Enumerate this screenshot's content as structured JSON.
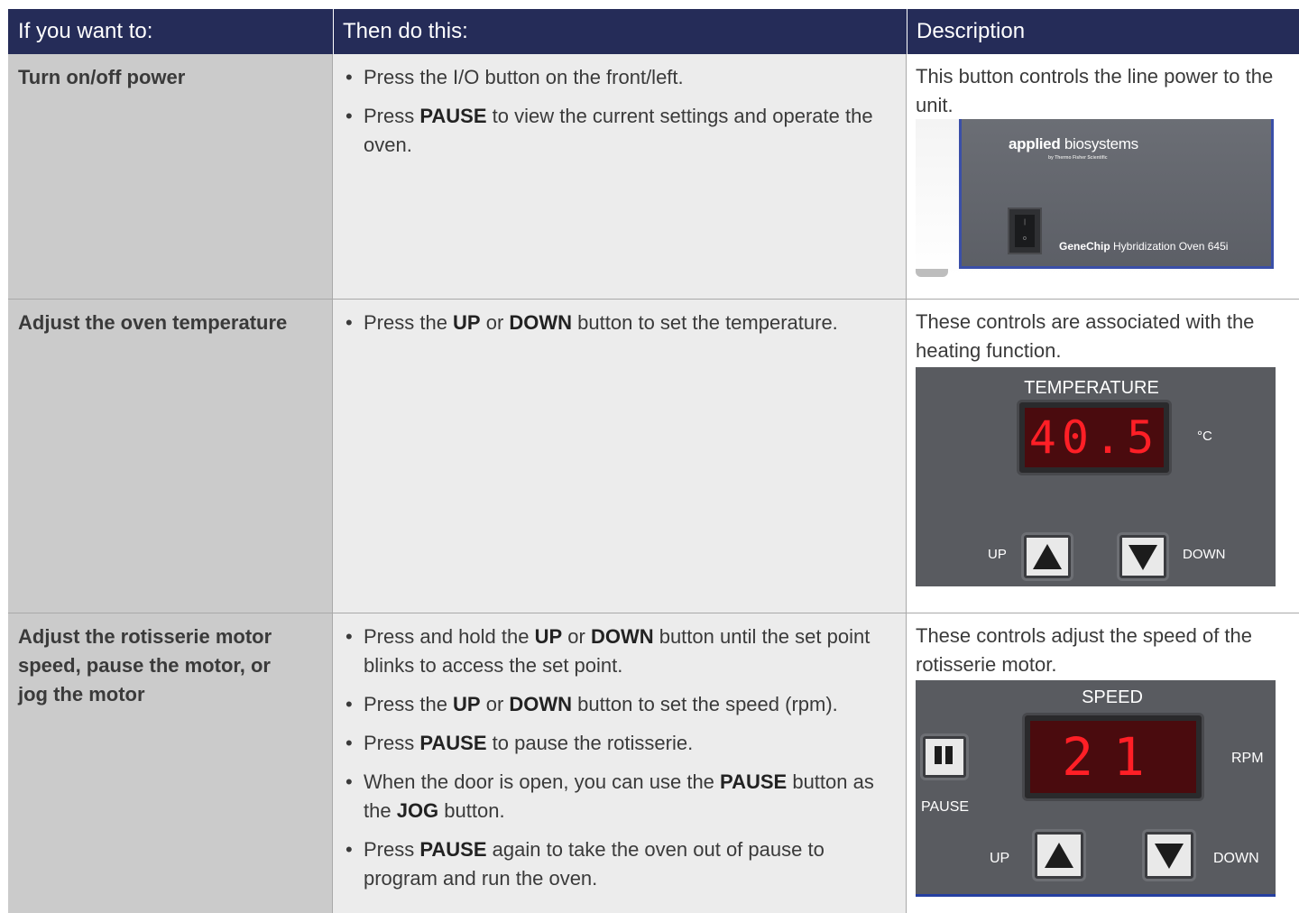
{
  "header": {
    "col1": "If you want to:",
    "col2": "Then do this:",
    "col3": "Description"
  },
  "rows": [
    {
      "want": "Turn on/off power",
      "steps": [
        {
          "parts": [
            {
              "t": "Press the I/O button on the front/left."
            }
          ]
        },
        {
          "parts": [
            {
              "t": "Press "
            },
            {
              "t": "PAUSE",
              "b": true
            },
            {
              "t": " to view the current settings and operate the oven."
            }
          ]
        }
      ],
      "description": "This button controls the line power to the unit.",
      "image": {
        "brand_bold": "applied",
        "brand_rest": " biosystems",
        "brand_sub": "by Thermo Fisher Scientific",
        "model_bold": "GeneChip",
        "model_rest": " Hybridization Oven 645i"
      }
    },
    {
      "want": "Adjust the oven temperature",
      "steps": [
        {
          "parts": [
            {
              "t": "Press the "
            },
            {
              "t": "UP",
              "b": true
            },
            {
              "t": " or "
            },
            {
              "t": "DOWN",
              "b": true
            },
            {
              "t": " button to set the temperature."
            }
          ]
        }
      ],
      "description": "These controls are associated with the heating function.",
      "image": {
        "title": "TEMPERATURE",
        "readout": "40.5",
        "unit": "°C",
        "up_label": "UP",
        "down_label": "DOWN"
      }
    },
    {
      "want": "Adjust the rotisserie motor speed, pause the motor, or jog the motor",
      "steps": [
        {
          "parts": [
            {
              "t": "Press and hold the "
            },
            {
              "t": "UP",
              "b": true
            },
            {
              "t": " or "
            },
            {
              "t": "DOWN",
              "b": true
            },
            {
              "t": " button until the set point blinks to access the set point."
            }
          ]
        },
        {
          "parts": [
            {
              "t": "Press the "
            },
            {
              "t": "UP",
              "b": true
            },
            {
              "t": " or "
            },
            {
              "t": "DOWN",
              "b": true
            },
            {
              "t": " button to set the speed (rpm)."
            }
          ]
        },
        {
          "parts": [
            {
              "t": "Press "
            },
            {
              "t": "PAUSE",
              "b": true
            },
            {
              "t": " to pause the rotisserie."
            }
          ]
        },
        {
          "parts": [
            {
              "t": "When the door is open, you can use the "
            },
            {
              "t": "PAUSE",
              "b": true
            },
            {
              "t": " button as the "
            },
            {
              "t": "JOG",
              "b": true
            },
            {
              "t": " button."
            }
          ]
        },
        {
          "parts": [
            {
              "t": "Press "
            },
            {
              "t": "PAUSE",
              "b": true
            },
            {
              "t": " again to take the oven out of pause to program and run the oven."
            }
          ]
        }
      ],
      "description": "These controls adjust the speed of the rotisserie motor.",
      "image": {
        "title": "SPEED",
        "readout": "21",
        "unit": "RPM",
        "pause_label": "PAUSE",
        "up_label": "UP",
        "down_label": "DOWN"
      }
    }
  ],
  "colors": {
    "header_bg": "#252c58",
    "col1_bg": "#cbcbcb",
    "col2_bg": "#ececec",
    "led_red": "#ff1f26"
  },
  "icons": [
    "power-switch-icon",
    "up-arrow-icon",
    "down-arrow-icon",
    "pause-icon"
  ]
}
